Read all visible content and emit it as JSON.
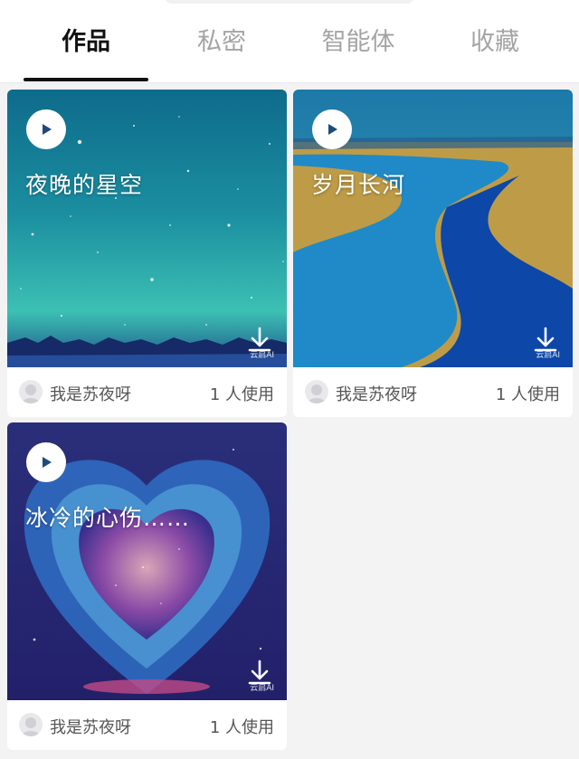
{
  "tabs": [
    {
      "label": "作品",
      "active": true
    },
    {
      "label": "私密",
      "active": false
    },
    {
      "label": "智能体",
      "active": false
    },
    {
      "label": "收藏",
      "active": false
    }
  ],
  "works": [
    {
      "title": "夜晚的星空",
      "author": "我是苏夜呀",
      "usage": "1 人使用",
      "watermark": "云启AI"
    },
    {
      "title": "岁月长河",
      "author": "我是苏夜呀",
      "usage": "1 人使用",
      "watermark": "云启AI"
    },
    {
      "title": "冰冷的心伤……",
      "author": "我是苏夜呀",
      "usage": "1 人使用",
      "watermark": "云启AI"
    }
  ],
  "icons": {
    "play": "play-icon",
    "download": "download-icon",
    "avatar": "avatar"
  }
}
